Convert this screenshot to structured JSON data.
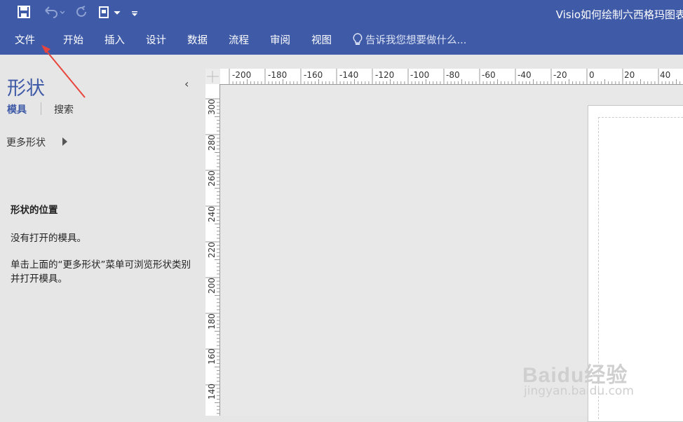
{
  "title_bar": {
    "title": "Visio如何绘制六西格玛图表"
  },
  "quick_access": {
    "save": "save-icon",
    "undo": "undo-icon",
    "redo": "redo-icon",
    "new": "new-document-icon",
    "customize": "customize-icon"
  },
  "ribbon": {
    "tabs": [
      "文件",
      "开始",
      "插入",
      "设计",
      "数据",
      "流程",
      "审阅",
      "视图"
    ],
    "tell_me": "告诉我您想要做什么..."
  },
  "shapes_pane": {
    "title": "形状",
    "tabs": [
      "模具",
      "搜索"
    ],
    "more_shapes": "更多形状",
    "section_title": "形状的位置",
    "no_stencil": "没有打开的模具。",
    "hint": "单击上面的“更多形状”菜单可浏览形状类别并打开模具。"
  },
  "ruler": {
    "horizontal": [
      "-200",
      "-180",
      "-160",
      "-140",
      "-120",
      "-100",
      "-80",
      "-60",
      "-40",
      "-20",
      "0",
      "20",
      "40"
    ],
    "vertical": [
      "300",
      "280",
      "260",
      "240",
      "220",
      "200",
      "180",
      "160",
      "140"
    ]
  },
  "watermark": {
    "main": "Baidu经验",
    "sub": "jingyan.baidu.com"
  },
  "colors": {
    "ribbon": "#3f5aa7",
    "pane_bg": "#e6e6e6",
    "arrow": "#e8453c"
  }
}
